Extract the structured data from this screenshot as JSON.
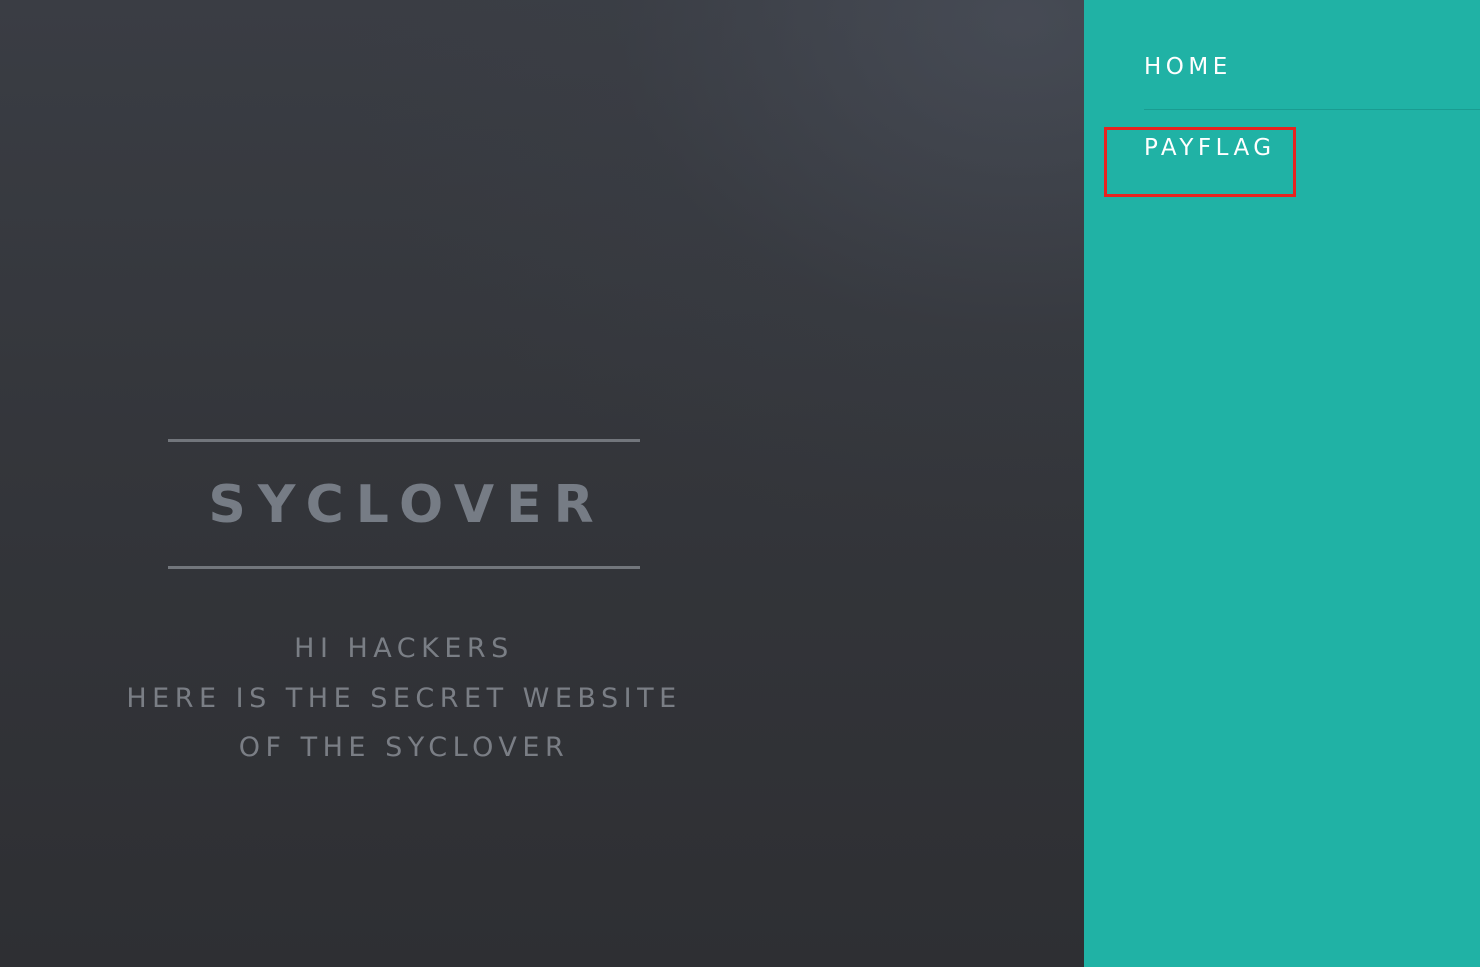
{
  "hero": {
    "title": "SYCLOVER",
    "subtitle_lines": [
      "HI HACKERS",
      "HERE IS THE SECRET WEBSITE",
      "OF THE SYCLOVER"
    ]
  },
  "nav": {
    "items": [
      {
        "label": "HOME"
      },
      {
        "label": "PAYFLAG"
      }
    ]
  },
  "colors": {
    "sidebar_bg": "#20b2a5",
    "main_bg": "#34363b",
    "highlight": "#e8231f"
  }
}
